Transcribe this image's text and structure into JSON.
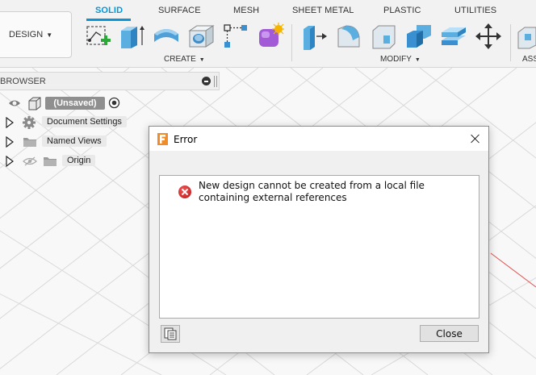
{
  "toolbar": {
    "workspace_button": "DESIGN",
    "tabs": [
      {
        "label": "SOLID",
        "active": true
      },
      {
        "label": "SURFACE",
        "active": false
      },
      {
        "label": "MESH",
        "active": false
      },
      {
        "label": "SHEET METAL",
        "active": false
      },
      {
        "label": "PLASTIC",
        "active": false
      },
      {
        "label": "UTILITIES",
        "active": false
      }
    ],
    "groups": {
      "create": "CREATE",
      "modify": "MODIFY",
      "assemble": "ASS"
    },
    "tools": {
      "create": [
        "create-sketch-icon",
        "extrude-icon",
        "revolve-icon",
        "hole-icon",
        "pattern-icon",
        "create-form-icon"
      ],
      "modify": [
        "press-pull-icon",
        "fillet-icon",
        "chamfer-icon",
        "combine-icon",
        "shell-icon",
        "move-icon"
      ]
    },
    "accent_color": "#0696d7"
  },
  "browser": {
    "title": "BROWSER",
    "root_label": "(Unsaved)",
    "items": [
      {
        "label": "Document Settings",
        "icon": "gear-icon"
      },
      {
        "label": "Named Views",
        "icon": "folder-icon"
      },
      {
        "label": "Origin",
        "icon": "folder-icon"
      }
    ]
  },
  "dialog": {
    "title": "Error",
    "message": "New design cannot be created from a local file containing external references",
    "close_label": "Close",
    "error_color": "#d32626"
  }
}
